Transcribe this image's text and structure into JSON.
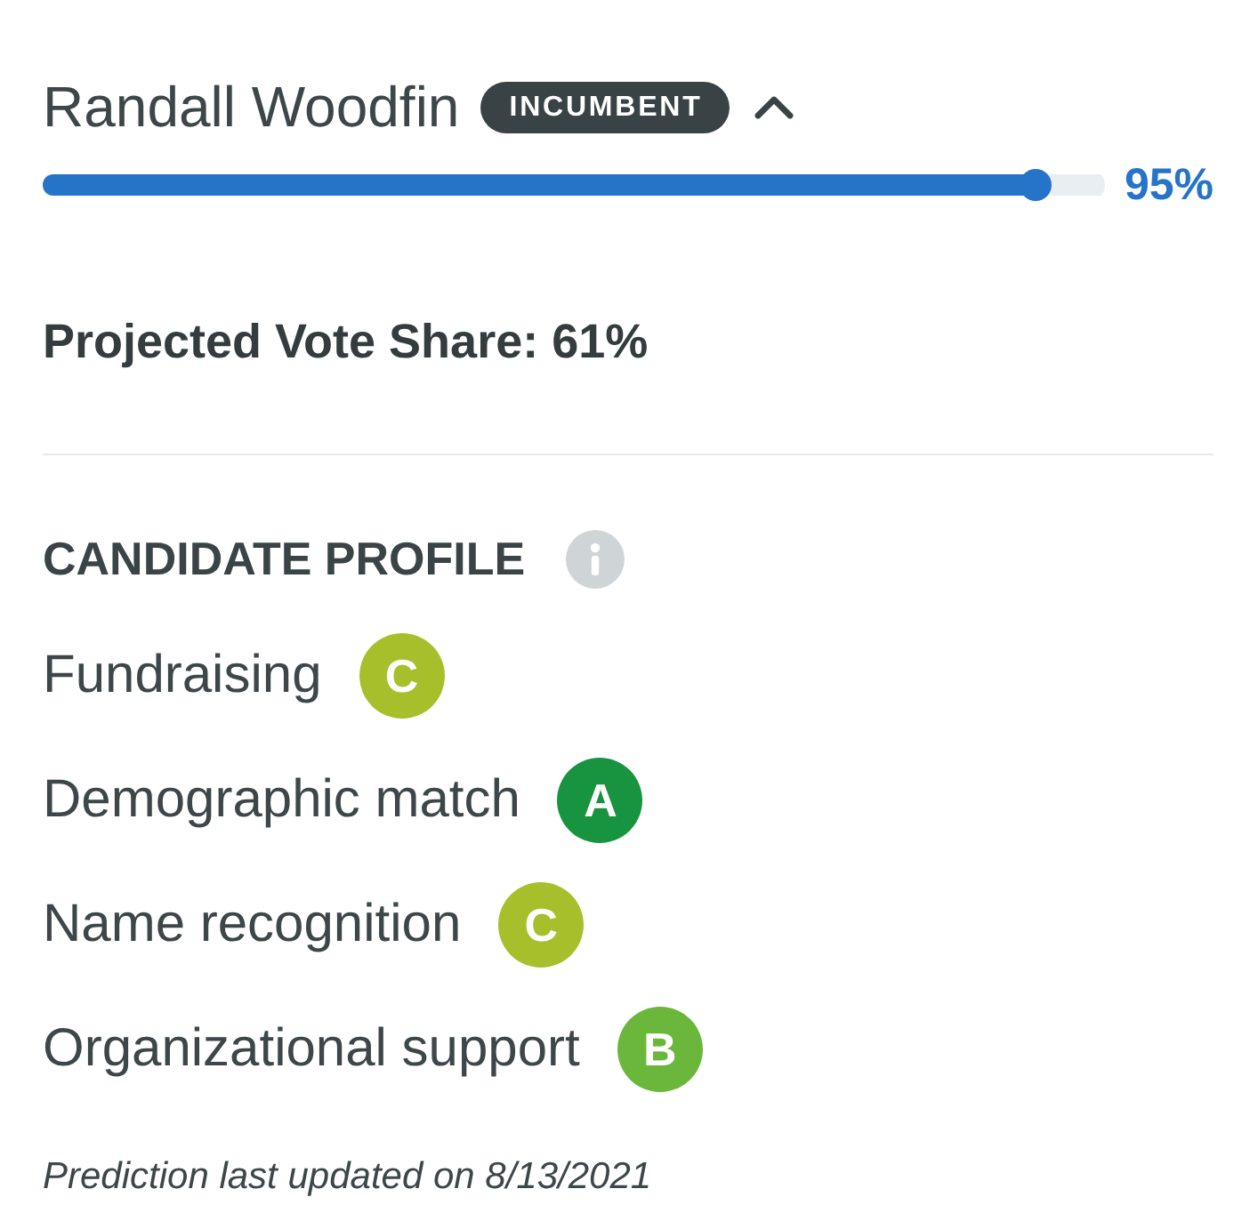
{
  "candidate": {
    "name": "Randall Woodfin",
    "badge": "INCUMBENT",
    "expanded": true,
    "win_chance": {
      "level": 0.95,
      "reading": "95%"
    }
  },
  "projection": {
    "text": "Projected Vote Share: 61%"
  },
  "profile": {
    "title": "CANDIDATE PROFILE",
    "items": [
      {
        "label": "Fundraising",
        "grade": "C",
        "color": "#a7bf2a"
      },
      {
        "label": "Demographic match",
        "grade": "A",
        "color": "#18933f"
      },
      {
        "label": "Name recognition",
        "grade": "C",
        "color": "#a7bf2a"
      },
      {
        "label": "Organizational support",
        "grade": "B",
        "color": "#6bb73b"
      }
    ]
  },
  "footer": {
    "text": "Prediction last updated on 8/13/2021"
  }
}
